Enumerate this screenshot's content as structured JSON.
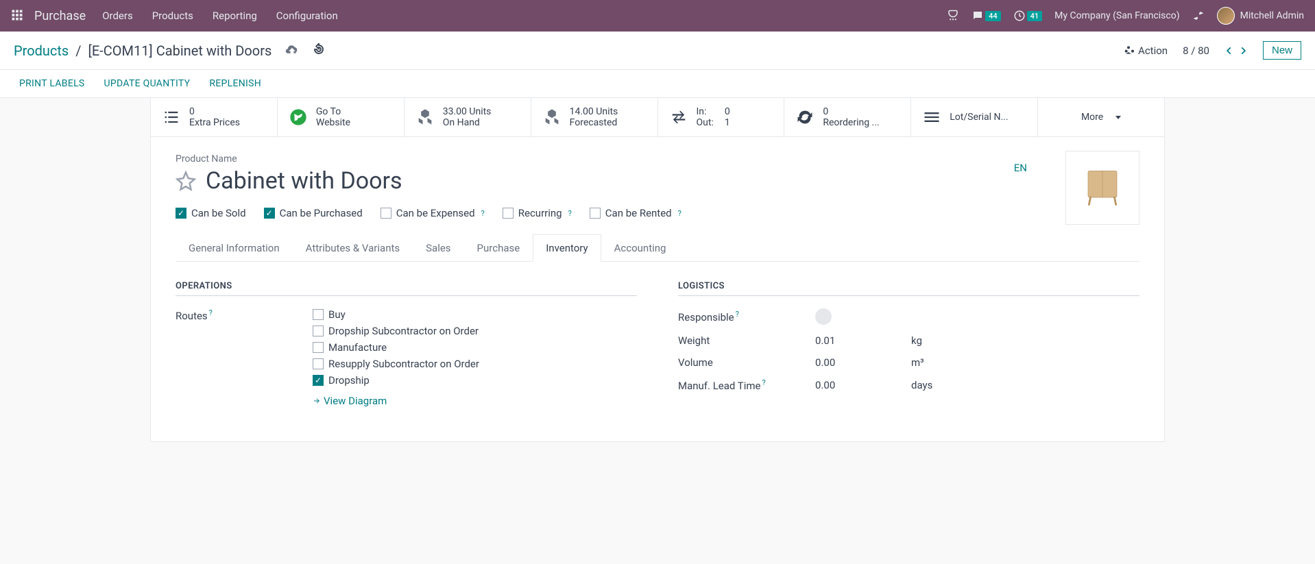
{
  "topbar": {
    "brand": "Purchase",
    "nav": [
      "Orders",
      "Products",
      "Reporting",
      "Configuration"
    ],
    "msg_badge": "44",
    "clock_badge": "41",
    "company": "My Company (San Francisco)",
    "user": "Mitchell Admin"
  },
  "breadcrumb": {
    "root": "Products",
    "current": "[E-COM11] Cabinet with Doors"
  },
  "header": {
    "action": "Action",
    "pager": "8 / 80",
    "new_btn": "New"
  },
  "actions": [
    "PRINT LABELS",
    "UPDATE QUANTITY",
    "REPLENISH"
  ],
  "stats": {
    "extra_prices": {
      "l1": "0",
      "l2": "Extra Prices"
    },
    "website": {
      "l1": "Go To",
      "l2": "Website"
    },
    "onhand": {
      "l1": "33.00 Units",
      "l2": "On Hand"
    },
    "forecasted": {
      "l1": "14.00 Units",
      "l2": "Forecasted"
    },
    "inout": {
      "in_label": "In:",
      "in_val": "0",
      "out_label": "Out:",
      "out_val": "1"
    },
    "reorder": {
      "l1": "0",
      "l2": "Reordering ..."
    },
    "lot": "Lot/Serial N...",
    "more": "More"
  },
  "product": {
    "label": "Product Name",
    "name": "Cabinet with Doors",
    "lang": "EN"
  },
  "checks": {
    "sold": "Can be Sold",
    "purchased": "Can be Purchased",
    "expensed": "Can be Expensed",
    "recurring": "Recurring",
    "rented": "Can be Rented"
  },
  "tabs": [
    "General Information",
    "Attributes & Variants",
    "Sales",
    "Purchase",
    "Inventory",
    "Accounting"
  ],
  "operations": {
    "title": "OPERATIONS",
    "routes_label": "Routes",
    "routes": [
      "Buy",
      "Dropship Subcontractor on Order",
      "Manufacture",
      "Resupply Subcontractor on Order",
      "Dropship"
    ],
    "routes_checked": [
      false,
      false,
      false,
      false,
      true
    ],
    "view_diagram": "View Diagram"
  },
  "logistics": {
    "title": "LOGISTICS",
    "responsible": "Responsible",
    "weight_label": "Weight",
    "weight_val": "0.01",
    "weight_unit": "kg",
    "volume_label": "Volume",
    "volume_val": "0.00",
    "volume_unit": "m³",
    "manuf_label": "Manuf. Lead Time",
    "manuf_val": "0.00",
    "manuf_unit": "days"
  }
}
